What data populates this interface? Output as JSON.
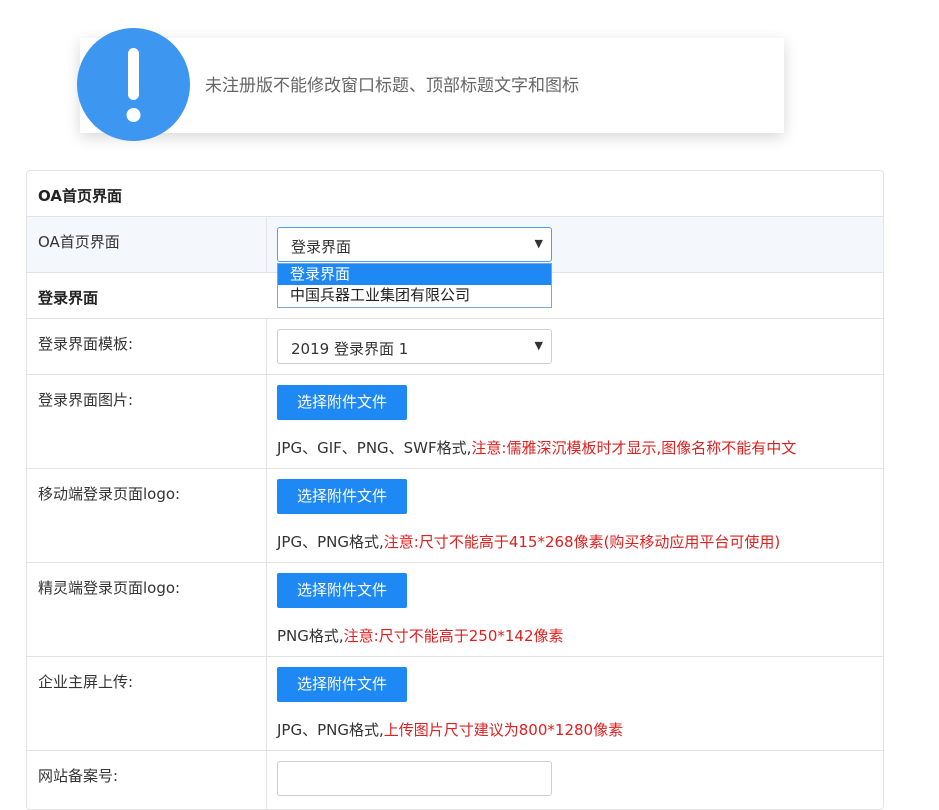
{
  "notice": {
    "icon": "exclamation-icon",
    "icon_color": "#3d96f0",
    "text": "未注册版不能修改窗口标题、顶部标题文字和图标"
  },
  "form": {
    "section_oa": {
      "title": "OA首页界面",
      "label": "OA首页界面",
      "selected": "登录界面",
      "options": [
        "登录界面",
        "中国兵器工业集团有限公司"
      ]
    },
    "section_login": {
      "title": "登录界面"
    },
    "template": {
      "label": "登录界面模板:",
      "selected": "2019 登录界面 1"
    },
    "login_image": {
      "label": "登录界面图片:",
      "button": "选择附件文件",
      "hint_plain": "JPG、GIF、PNG、SWF格式,",
      "hint_red": "注意:儒雅深沉模板时才显示,图像名称不能有中文"
    },
    "mobile_logo": {
      "label": "移动端登录页面logo:",
      "button": "选择附件文件",
      "hint_plain": "JPG、PNG格式,",
      "hint_red": "注意:尺寸不能高于415*268像素(购买移动应用平台可使用)"
    },
    "spirit_logo": {
      "label": "精灵端登录页面logo:",
      "button": "选择附件文件",
      "hint_plain": "PNG格式,",
      "hint_red": "注意:尺寸不能高于250*142像素"
    },
    "main_screen": {
      "label": "企业主屏上传:",
      "button": "选择附件文件",
      "hint_plain": "JPG、PNG格式,",
      "hint_red": "上传图片尺寸建议为800*1280像素"
    },
    "icp": {
      "label": "网站备案号:",
      "value": ""
    }
  },
  "colors": {
    "primary": "#1e88f5",
    "warning_text": "#e02020",
    "border": "#e3e3e3"
  }
}
